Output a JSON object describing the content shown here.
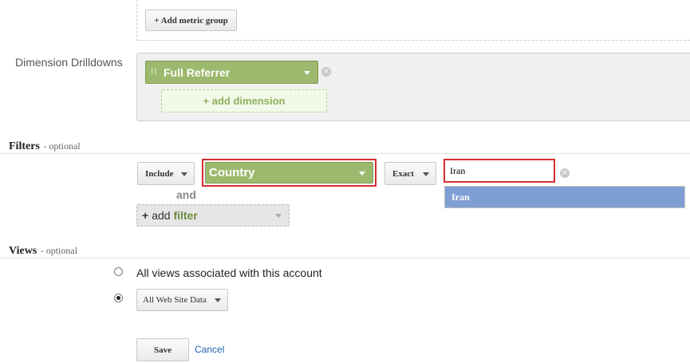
{
  "metrics": {
    "add_metric_group_label": "+ Add metric group"
  },
  "dimension_drilldowns": {
    "label": "Dimension Drilldowns",
    "selected_dimension": "Full Referrer",
    "add_dimension_label": "+ add dimension"
  },
  "filters": {
    "title": "Filters",
    "optional": "- optional",
    "include_value": "Include",
    "dimension_value": "Country",
    "match_value": "Exact",
    "input_value": "Iran",
    "suggestion": "Iran",
    "and_label": "and",
    "add_filter": {
      "plus": "+",
      "add": "add",
      "filter": "filter"
    }
  },
  "views": {
    "title": "Views",
    "optional": "- optional",
    "all_views_label": "All views associated with this account",
    "selected_view": "All Web Site Data"
  },
  "actions": {
    "save_label": "Save",
    "cancel_label": "Cancel"
  }
}
